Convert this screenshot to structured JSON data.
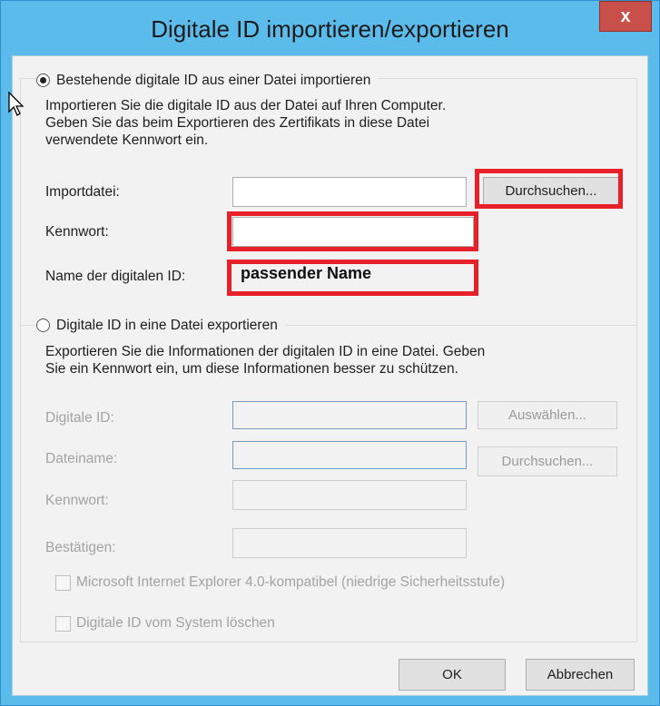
{
  "window": {
    "title": "Digitale ID importieren/exportieren",
    "close_glyph": "x"
  },
  "import": {
    "option_label": "Bestehende digitale ID aus einer Datei importieren",
    "selected": true,
    "description": [
      "Importieren Sie die digitale ID aus der Datei auf Ihren Computer.",
      "Geben Sie das beim Exportieren des Zertifikats in diese Datei",
      "verwendete Kennwort ein."
    ],
    "import_file_label": "Importdatei:",
    "import_file_value": "",
    "browse_label": "Durchsuchen...",
    "password_label": "Kennwort:",
    "password_value": "",
    "id_name_label": "Name der digitalen ID:",
    "id_name_value": "passender Name"
  },
  "export": {
    "option_label": "Digitale ID in eine Datei exportieren",
    "selected": false,
    "description": [
      "Exportieren Sie die Informationen der digitalen ID in eine Datei. Geben",
      "Sie ein Kennwort ein, um diese Informationen besser zu schützen."
    ],
    "digital_id_label": "Digitale ID:",
    "select_label": "Auswählen...",
    "filename_label": "Dateiname:",
    "browse_label": "Durchsuchen...",
    "password_label": "Kennwort:",
    "confirm_label": "Bestätigen:",
    "ie_compat_label": "Microsoft Internet Explorer 4.0-kompatibel (niedrige Sicherheitsstufe)",
    "delete_label": "Digitale ID vom System löschen"
  },
  "buttons": {
    "ok": "OK",
    "cancel": "Abbrechen"
  },
  "colors": {
    "title_bar": "#5bbcec",
    "close_button": "#c9504a",
    "highlight": "#e8202a"
  }
}
